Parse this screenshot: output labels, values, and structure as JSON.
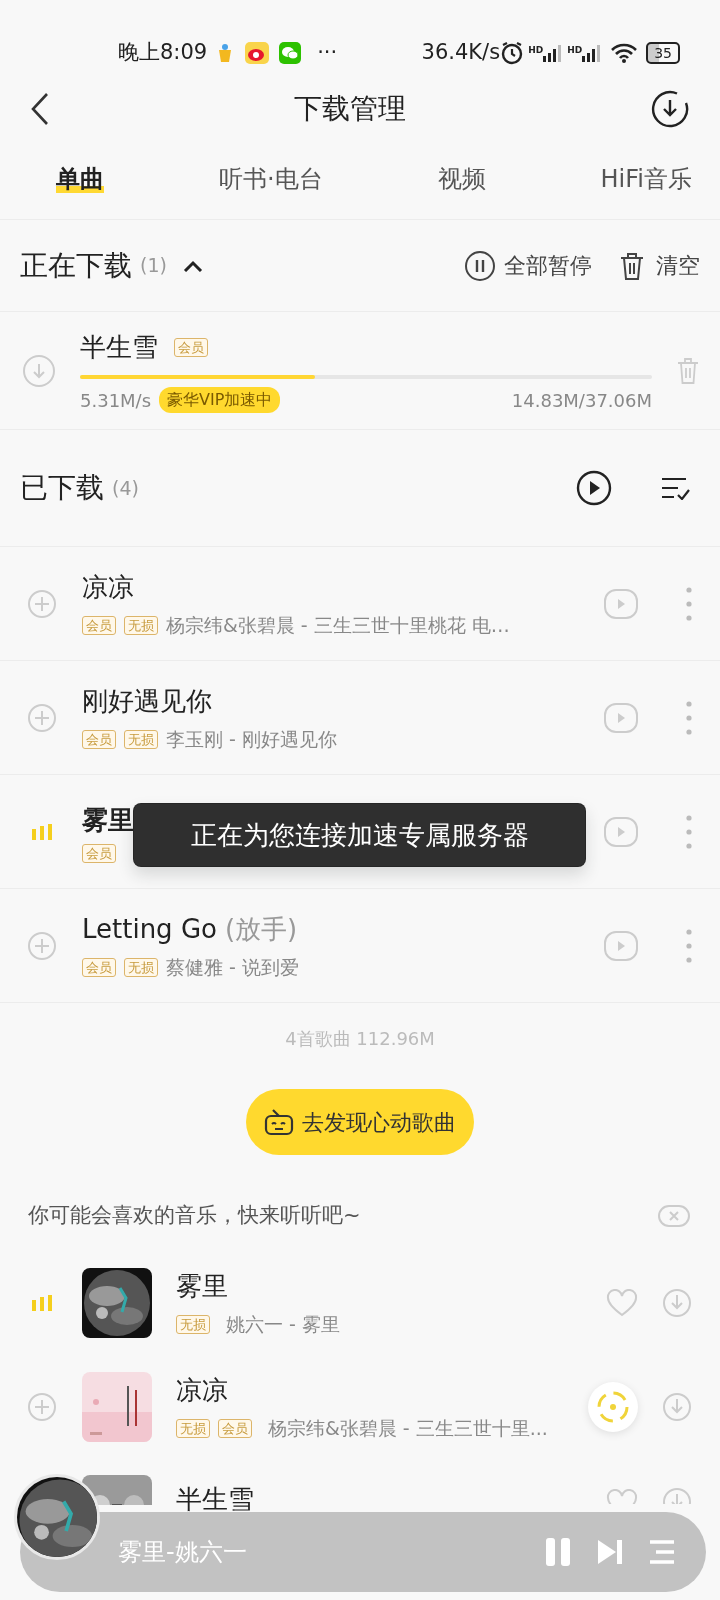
{
  "status_bar": {
    "time": "晚上8:09",
    "more": "···",
    "speed": "36.4K/s",
    "signal_labels": [
      "HD",
      "HD"
    ],
    "battery": "35"
  },
  "header": {
    "title": "下载管理"
  },
  "tabs": [
    {
      "label": "单曲",
      "selected": true
    },
    {
      "label": "听书·电台",
      "selected": false
    },
    {
      "label": "视频",
      "selected": false
    },
    {
      "label": "HiFi音乐",
      "selected": false
    }
  ],
  "downloading": {
    "title": "正在下载",
    "count": "(1)",
    "expanded": true,
    "actions": [
      {
        "kind": "pause",
        "label": "全部暂停"
      },
      {
        "kind": "clear",
        "label": "清空"
      }
    ],
    "items": [
      {
        "title": "半生雪",
        "tag": "会员",
        "level": 0.41,
        "speed": "5.31M/s",
        "badge": "豪华VIP加速中",
        "size": "14.83M/37.06M"
      }
    ]
  },
  "downloaded": {
    "title": "已下载",
    "count": "(4)",
    "songs": [
      {
        "title": "凉凉",
        "playing": false,
        "tags": [
          "会员",
          "无损"
        ],
        "subtitle": "杨宗纬&张碧晨 - 三生三世十里桃花 电…"
      },
      {
        "title": "刚好遇见你",
        "playing": false,
        "tags": [
          "会员",
          "无损"
        ],
        "subtitle": "李玉刚 - 刚好遇见你"
      },
      {
        "title": "雾里",
        "playing": true,
        "tags": [
          "会员"
        ]
      },
      {
        "title": "Letting Go",
        "title_note": "(放手)",
        "playing": false,
        "tags": [
          "会员",
          "无损"
        ],
        "subtitle": "蔡健雅 - 说到爱"
      }
    ],
    "summary": "4首歌曲 112.96M"
  },
  "discover_button": {
    "label": "去发现心动歌曲"
  },
  "recommend": {
    "title": "你可能会喜欢的音乐，快来听听吧~",
    "songs": [
      {
        "title": "雾里",
        "playing": true,
        "tags": [
          "无损"
        ],
        "subtitle": "姚六一 - 雾里",
        "locate_button": false,
        "cut": false
      },
      {
        "title": "凉凉",
        "playing": false,
        "tags": [
          "无损",
          "会员"
        ],
        "subtitle": "杨宗纬&张碧晨 - 三生三世十里...",
        "locate_button": true,
        "cut": false
      },
      {
        "title": "半生雪",
        "locate_button": false,
        "cut": true
      }
    ]
  },
  "toast": {
    "text": "正在为您连接加速专属服务器"
  },
  "player": {
    "title": "雾里-姚六一"
  }
}
